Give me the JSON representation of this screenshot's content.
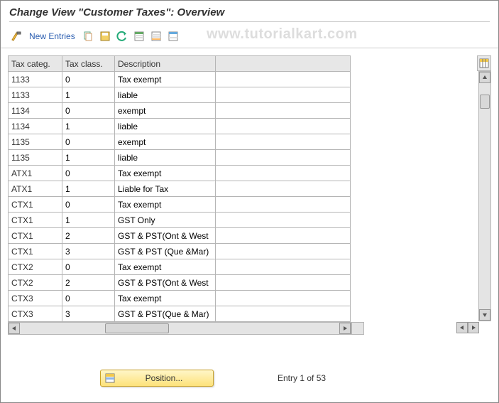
{
  "header": {
    "title": "Change View \"Customer Taxes\": Overview",
    "watermark": "www.tutorialkart.com"
  },
  "toolbar": {
    "new_entries_label": "New Entries"
  },
  "table": {
    "columns": {
      "tax_categ": "Tax categ.",
      "tax_class": "Tax class.",
      "description": "Description"
    },
    "rows": [
      {
        "categ": "1133",
        "class": "0",
        "desc": "Tax exempt",
        "desc_selected": true
      },
      {
        "categ": "1133",
        "class": "1",
        "desc": "liable"
      },
      {
        "categ": "1134",
        "class": "0",
        "desc": "exempt"
      },
      {
        "categ": "1134",
        "class": "1",
        "desc": "liable"
      },
      {
        "categ": "1135",
        "class": "0",
        "desc": "exempt"
      },
      {
        "categ": "1135",
        "class": "1",
        "desc": "liable"
      },
      {
        "categ": "ATX1",
        "class": "0",
        "desc": "Tax exempt"
      },
      {
        "categ": "ATX1",
        "class": "1",
        "desc": "Liable for Tax"
      },
      {
        "categ": "CTX1",
        "class": "0",
        "desc": "Tax exempt"
      },
      {
        "categ": "CTX1",
        "class": "1",
        "desc": "GST Only"
      },
      {
        "categ": "CTX1",
        "class": "2",
        "desc": "GST & PST(Ont & West"
      },
      {
        "categ": "CTX1",
        "class": "3",
        "desc": "GST & PST (Que &Mar)"
      },
      {
        "categ": "CTX2",
        "class": "0",
        "desc": "Tax exempt"
      },
      {
        "categ": "CTX2",
        "class": "2",
        "desc": "GST & PST(Ont & West"
      },
      {
        "categ": "CTX3",
        "class": "0",
        "desc": "Tax exempt"
      },
      {
        "categ": "CTX3",
        "class": "3",
        "desc": "GST & PST(Que & Mar)"
      }
    ]
  },
  "footer": {
    "position_label": "Position...",
    "entry_text": "Entry 1 of 53"
  }
}
